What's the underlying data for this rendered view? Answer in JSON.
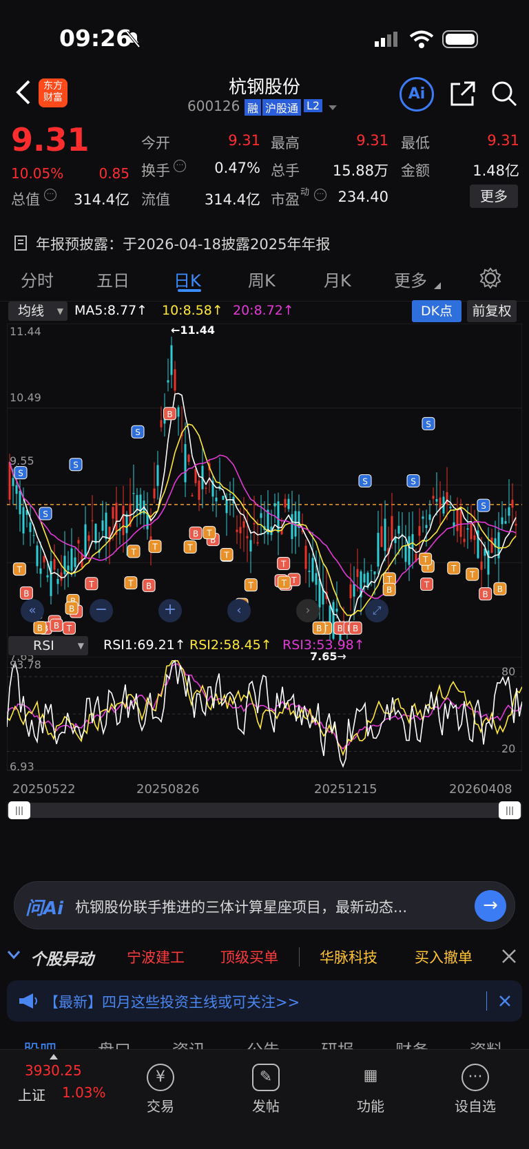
{
  "status_bar": {
    "time": "09:26"
  },
  "header": {
    "title": "杭钢股份",
    "code": "600126",
    "badges": [
      "融",
      "沪股通",
      "L2"
    ],
    "logo_text": "东方\n财富",
    "ai_label": "Ai"
  },
  "quote": {
    "price": "9.31",
    "change_pct": "10.05%",
    "change": "0.85",
    "open_label": "今开",
    "open": "9.31",
    "high_label": "最高",
    "high": "9.31",
    "low_label": "最低",
    "low": "9.31",
    "turnover_label": "换手",
    "turnover": "0.47%",
    "volume_label": "总手",
    "volume": "15.88万",
    "amount_label": "金额",
    "amount": "1.48亿",
    "total_value_label": "总值",
    "total_value": "314.4亿",
    "float_value_label": "流值",
    "float_value": "314.4亿",
    "pe_label": "市盈",
    "pe_sup": "动",
    "pe": "234.40",
    "more_button": "更多"
  },
  "notice": "年报预披露：于2026-04-18披露2025年年报",
  "tabs": [
    "分时",
    "五日",
    "日K",
    "周K",
    "月K",
    "更多"
  ],
  "active_tab": "日K",
  "kline": {
    "indicator_select": "均线",
    "ma5": "MA5:8.77↑",
    "ma10": "10:8.58↑",
    "ma20": "20:8.72↑",
    "dk_button": "DK点",
    "adjust_button": "前复权",
    "y_top": "11.44",
    "y_mid": "10.49",
    "y_mid2": "9.55",
    "y_bottom": "7.65",
    "max_label": "←11.44",
    "min_label": "7.65→"
  },
  "rsi": {
    "indicator_select": "RSI",
    "rsi1": "RSI1:69.21↑",
    "rsi2": "RSI2:58.45↑",
    "rsi3": "RSI3:53.98↑",
    "y_top": "93.78",
    "y_bottom": "6.93",
    "level_80": "80",
    "level_20": "20"
  },
  "chart_data": {
    "type": "candlestick",
    "x_ticks": [
      "20250522",
      "20250826",
      "20251215",
      "20260408"
    ],
    "price_range": [
      7.65,
      11.44
    ],
    "rsi_range": [
      6.93,
      93.78
    ],
    "ma_colors": {
      "ma5": "#ffffff",
      "ma10": "#ffe83a",
      "ma20": "#e23ad6"
    },
    "up_color": "#e8332a",
    "down_color": "#2ecdd6"
  },
  "ai_bar": {
    "logo": "问Ai",
    "text": "杭钢股份联手推进的三体计算星座项目，最新动态..."
  },
  "ticker": {
    "label": "个股异动",
    "items": [
      "宁波建工",
      "顶级买单",
      "华脉科技",
      "买入撤单"
    ]
  },
  "news": {
    "text": "【最新】四月这些投资主线或可关注>>"
  },
  "sub_tabs": [
    "股吧",
    "盘口",
    "资讯",
    "公告",
    "研报",
    "财务",
    "资料"
  ],
  "bottom_nav": {
    "index_value": "3930.25",
    "index_name": "上证",
    "index_change": "1.03%",
    "items": [
      "交易",
      "发帖",
      "功能",
      "设自选"
    ]
  }
}
